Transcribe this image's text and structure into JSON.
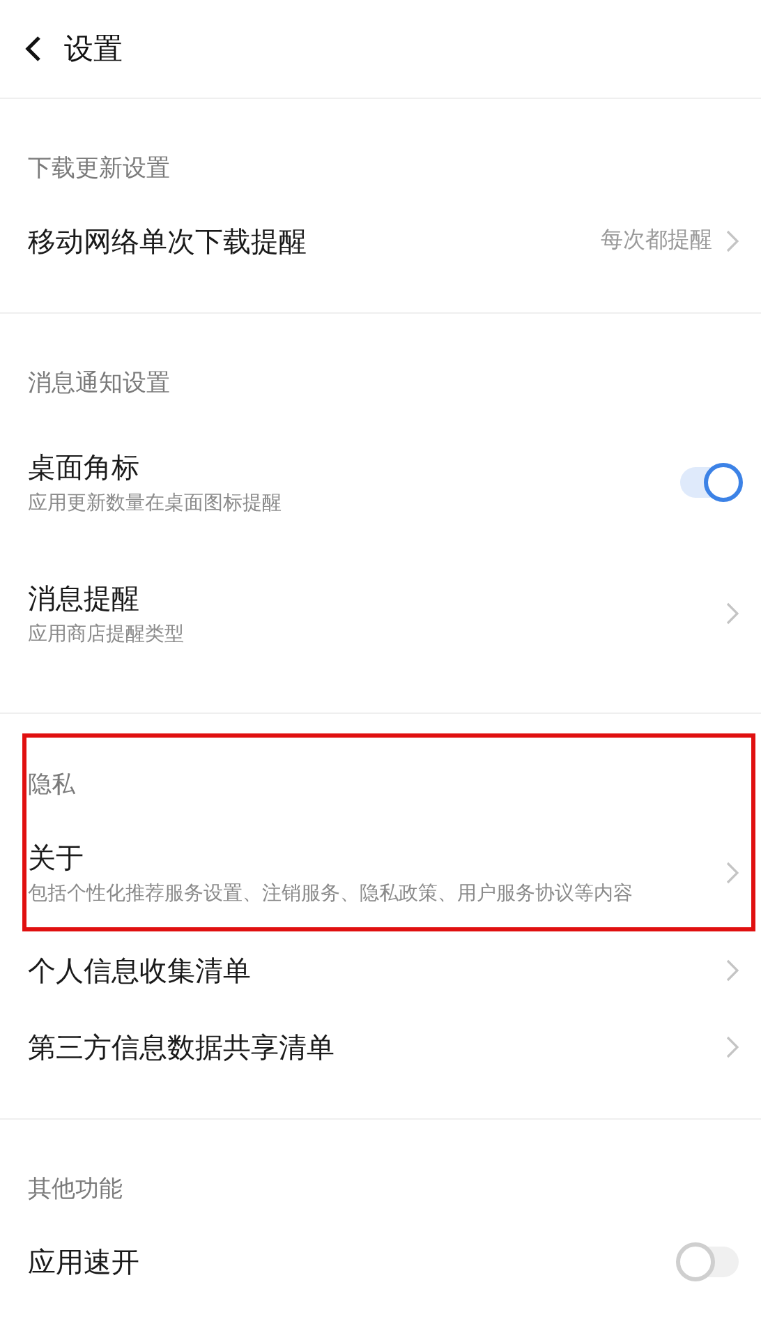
{
  "header": {
    "title": "设置"
  },
  "sections": [
    {
      "title": "下载更新设置",
      "highlighted": false,
      "items": [
        {
          "kind": "link",
          "title": "移动网络单次下载提醒",
          "value": "每次都提醒"
        }
      ]
    },
    {
      "title": "消息通知设置",
      "highlighted": false,
      "items": [
        {
          "kind": "toggle",
          "title": "桌面角标",
          "subtitle": "应用更新数量在桌面图标提醒",
          "on": true
        },
        {
          "kind": "link",
          "title": "消息提醒",
          "subtitle": "应用商店提醒类型"
        }
      ]
    },
    {
      "title": "隐私",
      "highlighted": true,
      "items": [
        {
          "kind": "link",
          "title": "关于",
          "subtitle": "包括个性化推荐服务设置、注销服务、隐私政策、用户服务协议等内容"
        }
      ],
      "more_items": [
        {
          "kind": "link",
          "title": "个人信息收集清单"
        },
        {
          "kind": "link",
          "title": "第三方信息数据共享清单"
        }
      ]
    },
    {
      "title": "其他功能",
      "highlighted": false,
      "items": [
        {
          "kind": "toggle",
          "title": "应用速开",
          "on": false
        }
      ]
    }
  ]
}
